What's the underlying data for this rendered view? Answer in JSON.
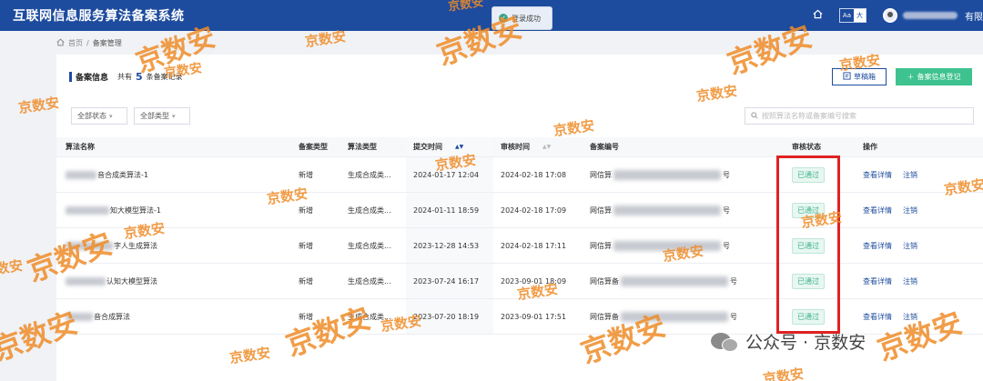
{
  "header": {
    "app_title": "互联网信息服务算法备案系统",
    "font_toggle": [
      "Aa",
      "大"
    ],
    "user_org": "有限"
  },
  "toast": {
    "text": "登录成功"
  },
  "breadcrumb": {
    "home": "首页",
    "sep": "/",
    "current": "备案管理"
  },
  "section": {
    "title": "备案信息",
    "count_label": "共有",
    "count": "5",
    "count_suffix": "条备案记录"
  },
  "buttons": {
    "draft": "草稿箱",
    "register": "备案信息登记"
  },
  "filters": {
    "status": "全部状态",
    "type": "全部类型"
  },
  "search": {
    "placeholder": "按照算法名称或备案编号搜索"
  },
  "table": {
    "headers": {
      "name": "算法名称",
      "filing_type": "备案类型",
      "algo_type": "算法类型",
      "submit_time": "提交时间",
      "review_time": "审核时间",
      "reg_no": "备案编号",
      "status": "审核状态",
      "ops": "操作"
    },
    "rows": [
      {
        "name": "音合成类算法-1",
        "filing_type": "新增",
        "algo_type": "生成合成类...",
        "submit_time": "2024-01-17 12:04",
        "review_time": "2024-02-18 17:08",
        "reg_no_prefix": "网信算",
        "reg_no_suffix": "号",
        "status": "已通过",
        "op_detail": "查看详情",
        "op_cancel": "注销"
      },
      {
        "name": "知大模型算法-1",
        "filing_type": "新增",
        "algo_type": "生成合成类...",
        "submit_time": "2024-01-11 18:59",
        "review_time": "2024-02-18 17:09",
        "reg_no_prefix": "网信算",
        "reg_no_suffix": "号",
        "status": "已通过",
        "op_detail": "查看详情",
        "op_cancel": "注销"
      },
      {
        "name": "字人生成算法",
        "filing_type": "新增",
        "algo_type": "生成合成类...",
        "submit_time": "2023-12-28 14:53",
        "review_time": "2024-02-18 17:11",
        "reg_no_prefix": "网信算",
        "reg_no_suffix": "号",
        "status": "已通过",
        "op_detail": "查看详情",
        "op_cancel": "注销"
      },
      {
        "name": "认知大模型算法",
        "filing_type": "新增",
        "algo_type": "生成合成类...",
        "submit_time": "2023-07-24 16:17",
        "review_time": "2023-09-01 18:09",
        "reg_no_prefix": "网信算备",
        "reg_no_suffix": "号",
        "status": "已通过",
        "op_detail": "查看详情",
        "op_cancel": "注销"
      },
      {
        "name": "音合成算法",
        "filing_type": "新增",
        "algo_type": "生成合成类...",
        "submit_time": "2023-07-20 18:19",
        "review_time": "2023-09-01 17:51",
        "reg_no_prefix": "网信算备",
        "reg_no_suffix": "号",
        "status": "已通过",
        "op_detail": "查看详情",
        "op_cancel": "注销"
      }
    ]
  },
  "watermark_text": "京数安",
  "footer_brand": {
    "text": "公众号 · 京数安"
  },
  "colors": {
    "header_bg": "#1d4b9e",
    "success": "#3db28a",
    "primary_button": "#3ec28f",
    "highlight": "#e02222",
    "watermark": "#ee8c28"
  }
}
